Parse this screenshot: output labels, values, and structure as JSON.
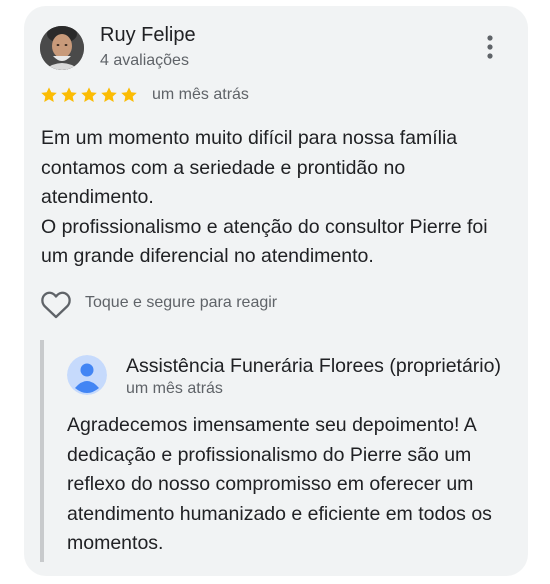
{
  "review": {
    "author_name": "Ruy Felipe",
    "author_reviews": "4 avaliações",
    "rating": 5,
    "date": "um mês atrás",
    "text_lines": [
      "Em um momento muito difícil para nossa família contamos com a seriedade e prontidão no atendimento.",
      "O profissionalismo e atenção do consultor Pierre foi um grande diferencial no atendimento."
    ],
    "react_label": "Toque e segure para reagir"
  },
  "reply": {
    "owner_name": "Assistência Funerária Florees (proprietário)",
    "date": "um mês atrás",
    "text": "Agradecemos imensamente seu depoimento! A dedicação e profissionalismo do Pierre são um reflexo do nosso compromisso em oferecer um atendimento humanizado e eficiente em todos os momentos."
  },
  "colors": {
    "card_background": "#f1f3f4",
    "star": "#fbbc04",
    "primary_text": "#202124",
    "secondary_text": "#5f6368",
    "owner_avatar": "#4285f4"
  },
  "icons": {
    "more": "more-vert-icon",
    "star": "star-icon",
    "react": "heart-outline-icon",
    "owner_avatar": "default-person-icon"
  }
}
